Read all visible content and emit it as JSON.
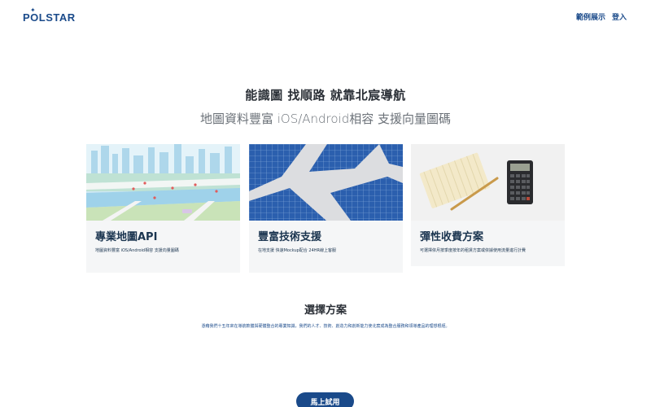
{
  "header": {
    "logo_text": "POLSTAR",
    "nav": {
      "examples": "範例展示",
      "login": "登入"
    }
  },
  "hero": {
    "title": "能識圖 找順路 就靠北宸導航",
    "subtitle": "地圖資料豐富 iOS/Android相容 支援向量圖碼"
  },
  "cards": [
    {
      "title": "專業地圖API",
      "desc": "地圖資料豐富 iOS/Android相容 支援向量圖碼",
      "image": "city-map-image"
    },
    {
      "title": "豐富技術支援",
      "desc": "在地支援 快速Mockup配合 24HR線上客服",
      "image": "solar-panel-image"
    },
    {
      "title": "彈性收費方案",
      "desc": "可選擇依月按季度按年的租賃方案或依據使用流量進行計費",
      "image": "calculator-image"
    }
  ],
  "pricing": {
    "title": "選擇方案",
    "desc": "憑藉我們十五年來在導航軟體與硬體整合的專業知識，我們的人才、技術、創造力和創新能力使北宸成為整合服務和領導產品的理想根經。"
  },
  "cta": {
    "label": "馬上試用"
  },
  "colors": {
    "brand": "#1a4a8a",
    "card_bg": "#f5f6f7"
  }
}
